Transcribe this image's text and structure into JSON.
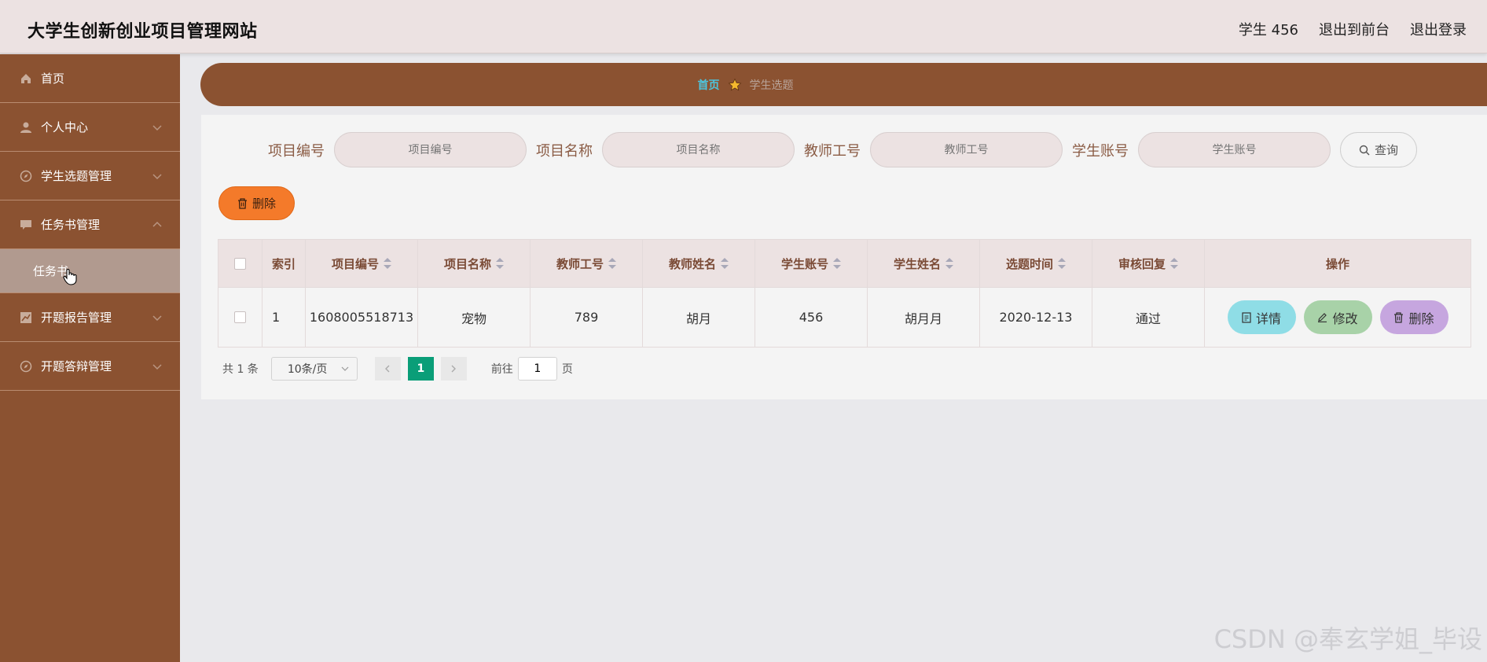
{
  "header": {
    "title": "大学生创新创业项目管理网站",
    "user": "学生 456",
    "to_front": "退出到前台",
    "logout": "退出登录"
  },
  "sidebar": {
    "items": [
      {
        "label": "首页",
        "icon": "home-icon"
      },
      {
        "label": "个人中心",
        "icon": "user-icon"
      },
      {
        "label": "学生选题管理",
        "icon": "compass-icon"
      },
      {
        "label": "任务书管理",
        "icon": "message-icon"
      },
      {
        "label": "开题报告管理",
        "icon": "chart-icon"
      },
      {
        "label": "开题答辩管理",
        "icon": "compass-icon"
      }
    ],
    "sub_item": "任务书"
  },
  "breadcrumb": {
    "home": "首页",
    "current": "学生选题"
  },
  "search": {
    "fields": [
      {
        "label": "项目编号",
        "placeholder": "项目编号"
      },
      {
        "label": "项目名称",
        "placeholder": "项目名称"
      },
      {
        "label": "教师工号",
        "placeholder": "教师工号"
      },
      {
        "label": "学生账号",
        "placeholder": "学生账号"
      }
    ],
    "query_label": "查询"
  },
  "toolbar": {
    "delete_label": "删除"
  },
  "table": {
    "headers": [
      "索引",
      "项目编号",
      "项目名称",
      "教师工号",
      "教师姓名",
      "学生账号",
      "学生姓名",
      "选题时间",
      "审核回复",
      "操作"
    ],
    "rows": [
      {
        "index": "1",
        "project_no": "1608005518713",
        "project_name": "宠物",
        "teacher_no": "789",
        "teacher_name": "胡月",
        "student_account": "456",
        "student_name": "胡月月",
        "time": "2020-12-13",
        "reply": "通过"
      }
    ],
    "actions": {
      "detail": "详情",
      "edit": "修改",
      "delete": "删除"
    }
  },
  "pagination": {
    "total": "共 1 条",
    "page_size": "10条/页",
    "current_page": "1",
    "goto_label": "前往",
    "goto_value": "1",
    "page_suffix": "页"
  },
  "watermark": "CSDN @奉玄学姐_毕设",
  "colors": {
    "sidebar": "#8b5231",
    "header": "#ece2e2",
    "accent_orange": "#f47a2a",
    "page_active": "#0a9e78"
  }
}
